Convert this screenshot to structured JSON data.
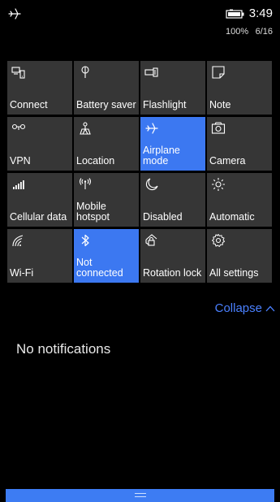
{
  "status": {
    "airplane_icon": "airplane-icon",
    "battery_icon": "battery-charging-icon",
    "time": "3:49",
    "battery_percent": "100%",
    "date": "6/16"
  },
  "tiles": [
    {
      "label": "Connect",
      "icon": "connect-icon",
      "active": false
    },
    {
      "label": "Battery saver",
      "icon": "battery-saver-icon",
      "active": false
    },
    {
      "label": "Flashlight",
      "icon": "flashlight-icon",
      "active": false
    },
    {
      "label": "Note",
      "icon": "note-icon",
      "active": false
    },
    {
      "label": "VPN",
      "icon": "vpn-icon",
      "active": false
    },
    {
      "label": "Location",
      "icon": "location-icon",
      "active": false
    },
    {
      "label": "Airplane mode",
      "icon": "airplane-icon",
      "active": true
    },
    {
      "label": "Camera",
      "icon": "camera-icon",
      "active": false
    },
    {
      "label": "Cellular data",
      "icon": "cellular-icon",
      "active": false
    },
    {
      "label": "Mobile hotspot",
      "icon": "hotspot-icon",
      "active": false
    },
    {
      "label": "Disabled",
      "icon": "moon-icon",
      "active": false
    },
    {
      "label": "Automatic",
      "icon": "brightness-icon",
      "active": false
    },
    {
      "label": "Wi-Fi",
      "icon": "wifi-icon",
      "active": false
    },
    {
      "label": "Not connected",
      "icon": "bluetooth-icon",
      "active": true
    },
    {
      "label": "Rotation lock",
      "icon": "rotation-lock-icon",
      "active": false
    },
    {
      "label": "All settings",
      "icon": "settings-gear-icon",
      "active": false
    }
  ],
  "collapse_label": "Collapse",
  "notifications_text": "No notifications",
  "colors": {
    "accent": "#3c78f1",
    "tile_bg": "#363636",
    "collapse_text": "#4a80ff"
  }
}
